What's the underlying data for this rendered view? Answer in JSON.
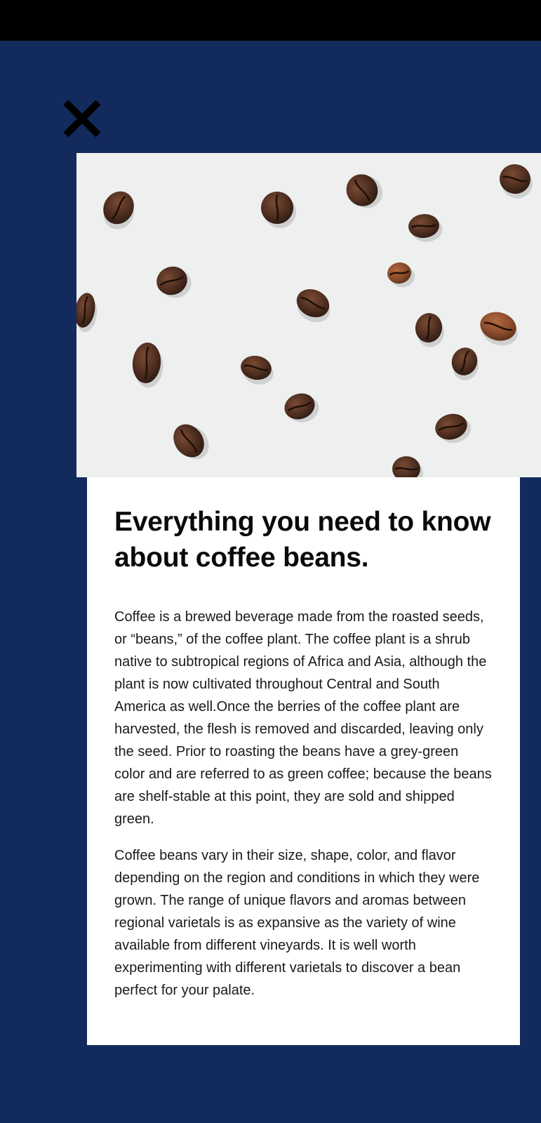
{
  "article": {
    "title": "Everything you need to know about coffee beans.",
    "paragraphs": [
      "Coffee is a brewed beverage made from the roasted seeds, or “beans,” of the coffee plant. The coffee plant is a shrub native to subtropical regions of Africa and Asia, although the plant is now cultivated throughout Central and South America as well.Once the berries of the coffee plant are harvested, the flesh is removed and discarded, leaving only the seed. Prior to roasting the beans have a grey-green color and are referred to as green coffee; because the beans are shelf-stable at this point, they are sold and shipped green.",
      "Coffee beans vary in their size, shape, color, and flavor depending on the region and conditions in which they were grown. The range of unique flavors and aromas between regional varietals is as expansive as the variety of wine available from different vineyards. It is well worth experimenting with different varietals to discover a bean perfect for your palate."
    ]
  },
  "icons": {
    "close": "close-icon"
  },
  "colors": {
    "background": "#122b5c",
    "status_bar": "#000000",
    "card": "#ffffff",
    "title_text": "#0a0a0a",
    "body_text": "#1a1a1a",
    "image_background": "#eeefef",
    "bean_dark": "#4a2c20",
    "bean_medium": "#6b3f2a",
    "bean_light": "#8a4f2e"
  }
}
